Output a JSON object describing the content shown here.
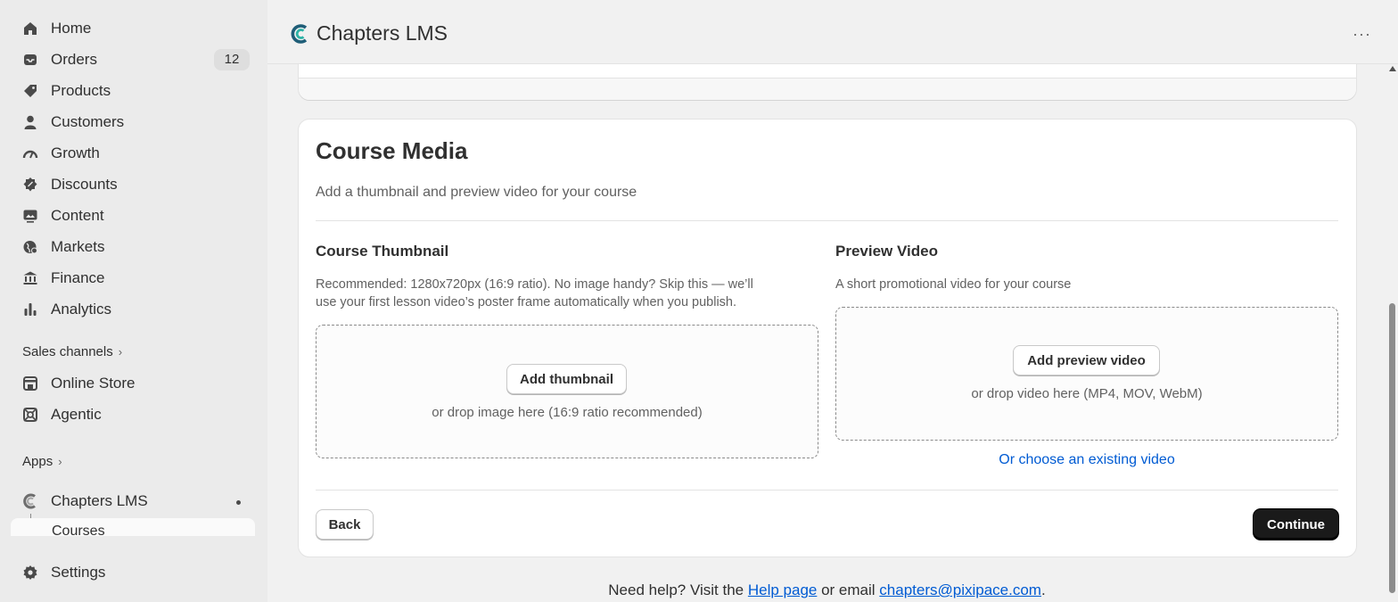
{
  "sidebar": {
    "items": [
      {
        "label": "Home",
        "icon": "home-icon"
      },
      {
        "label": "Orders",
        "icon": "inbox-icon",
        "badge": "12"
      },
      {
        "label": "Products",
        "icon": "tag-icon"
      },
      {
        "label": "Customers",
        "icon": "person-icon"
      },
      {
        "label": "Growth",
        "icon": "gauge-icon"
      },
      {
        "label": "Discounts",
        "icon": "discount-icon"
      },
      {
        "label": "Content",
        "icon": "image-icon"
      },
      {
        "label": "Markets",
        "icon": "globe-icon"
      },
      {
        "label": "Finance",
        "icon": "bank-icon"
      },
      {
        "label": "Analytics",
        "icon": "bar-chart-icon"
      }
    ],
    "sales_channels_label": "Sales channels",
    "channels": [
      {
        "label": "Online Store",
        "icon": "store-icon"
      },
      {
        "label": "Agentic",
        "icon": "agentic-icon"
      }
    ],
    "apps_label": "Apps",
    "app": {
      "label": "Chapters LMS",
      "sub_label": "Courses"
    },
    "settings_label": "Settings"
  },
  "header": {
    "title": "Chapters LMS",
    "more": "···"
  },
  "card": {
    "title": "Course Media",
    "description": "Add a thumbnail and preview video for your course",
    "thumbnail": {
      "title": "Course Thumbnail",
      "text_line1": "Recommended: 1280x720px (16:9 ratio). No image handy? Skip this — we’ll",
      "text_line2": "use your first lesson video’s poster frame automatically when you publish.",
      "button": "Add thumbnail",
      "hint": "or drop image here (16:9 ratio recommended)"
    },
    "preview": {
      "title": "Preview Video",
      "text": "A short promotional video for your course",
      "button": "Add preview video",
      "hint": "or drop video here (MP4, MOV, WebM)",
      "choose_link": "Or choose an existing video"
    },
    "back_button": "Back",
    "continue_button": "Continue"
  },
  "help": {
    "prefix": "Need help? Visit the ",
    "link_help": "Help page",
    "middle": " or email ",
    "link_email": "chapters@pixipace.com",
    "suffix": "."
  },
  "colors": {
    "link": "#005bd3",
    "primary_button": "#1a1a1a",
    "sidebar_bg": "#ebebeb"
  }
}
